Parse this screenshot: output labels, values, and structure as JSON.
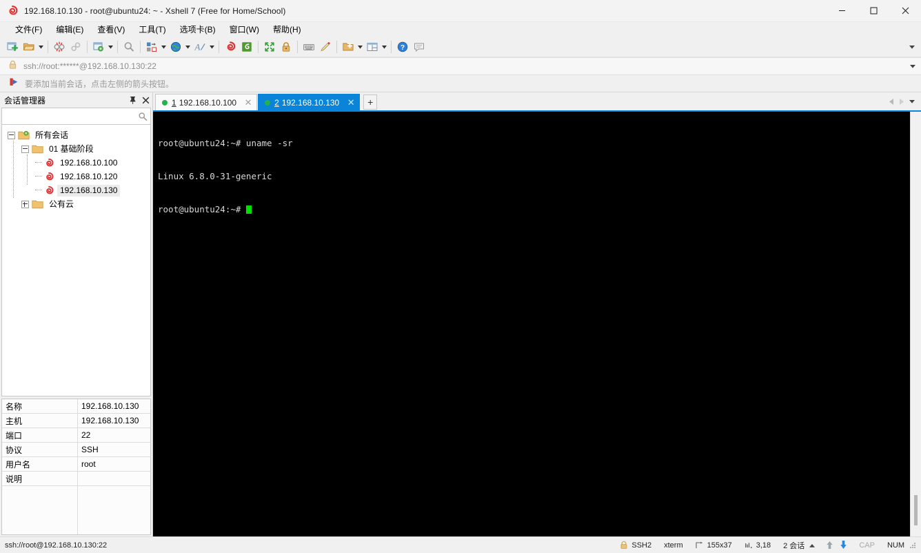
{
  "window": {
    "title": "192.168.10.130 - root@ubuntu24: ~ - Xshell 7 (Free for Home/School)",
    "app_icon": "xshell-logo-icon",
    "minimize_label": "─",
    "maximize_label": "□",
    "close_label": "✕"
  },
  "menu": {
    "items": [
      {
        "label": "文件(F)",
        "name": "menu-file"
      },
      {
        "label": "编辑(E)",
        "name": "menu-edit"
      },
      {
        "label": "查看(V)",
        "name": "menu-view"
      },
      {
        "label": "工具(T)",
        "name": "menu-tools"
      },
      {
        "label": "选项卡(B)",
        "name": "menu-tabs"
      },
      {
        "label": "窗口(W)",
        "name": "menu-window"
      },
      {
        "label": "帮助(H)",
        "name": "menu-help"
      }
    ]
  },
  "toolbar": {
    "buttons": [
      "new-session-icon",
      "open-folder-icon",
      "disconnect-icon",
      "reconnect-icon",
      "session-properties-icon",
      "find-icon",
      "transfer-layout-icon",
      "globe-encoding-icon",
      "font-icon",
      "xshell-icon",
      "xftp-icon",
      "fullscreen-icon",
      "lock-icon",
      "keyboard-icon",
      "highlight-pen-icon",
      "add-folder-icon",
      "split-layout-icon",
      "help-icon",
      "chat-icon"
    ],
    "overflow_label": "▾"
  },
  "address_bar": {
    "icon": "lock-icon",
    "value": "ssh://root:******@192.168.10.130:22",
    "dropdown_label": "▾"
  },
  "notification": {
    "icon": "red-arrow-icon",
    "message": "要添加当前会话，点击左侧的箭头按钮。"
  },
  "session_manager": {
    "title": "会话管理器",
    "pin_label": "⚑",
    "close_label": "✕",
    "search": {
      "value": "",
      "placeholder": "",
      "icon": "search-icon"
    },
    "tree": {
      "root": {
        "label": "所有会话",
        "icon": "folder-gear-icon",
        "expanded": true
      },
      "group": {
        "label": "01 基础阶段",
        "icon": "folder-icon",
        "expanded": true
      },
      "sessions": [
        {
          "label": "192.168.10.100",
          "icon": "xshell-session-icon",
          "selected": false
        },
        {
          "label": "192.168.10.120",
          "icon": "xshell-session-icon",
          "selected": false
        },
        {
          "label": "192.168.10.130",
          "icon": "xshell-session-icon",
          "selected": true
        }
      ],
      "cloud": {
        "label": "公有云",
        "icon": "folder-icon",
        "expanded": false
      }
    }
  },
  "properties": {
    "rows": [
      {
        "key": "名称",
        "value": "192.168.10.130"
      },
      {
        "key": "主机",
        "value": "192.168.10.130"
      },
      {
        "key": "端口",
        "value": "22"
      },
      {
        "key": "协议",
        "value": "SSH"
      },
      {
        "key": "用户名",
        "value": "root"
      },
      {
        "key": "说明",
        "value": ""
      }
    ]
  },
  "tabs": {
    "items": [
      {
        "number": "1",
        "label": "192.168.10.100",
        "active": false,
        "status": "connected",
        "close_label": "✕"
      },
      {
        "number": "2",
        "label": "192.168.10.130",
        "active": true,
        "status": "connected",
        "close_label": "✕"
      }
    ],
    "add_label": "+",
    "nav_prev": "◀",
    "nav_next": "▶",
    "nav_menu": "▾"
  },
  "terminal": {
    "lines": [
      "root@ubuntu24:~# uname -sr",
      "Linux 6.8.0-31-generic",
      "root@ubuntu24:~# "
    ],
    "background": "#000000",
    "foreground": "#d8d8d8",
    "cursor_color": "#00e000"
  },
  "statusbar": {
    "connection": "ssh://root@192.168.10.130:22",
    "protocol": "SSH2",
    "terminal_type": "xterm",
    "size": "155x37",
    "cursor_pos": "3,18",
    "sessions": "2 会话",
    "sessions_caret": "▴",
    "upload_icon": "arrow-up-icon",
    "download_icon": "arrow-down-icon",
    "caps": "CAP",
    "num": "NUM",
    "lock_icon": "lock-icon",
    "size_icon": "terminal-size-icon",
    "pos_icon": "cursor-pos-icon"
  },
  "colors": {
    "accent": "#0a84d8",
    "connected_dot": "#22b14c",
    "terminal_bg": "#000000",
    "cursor": "#00e000",
    "panel_bg": "#f0f0f0"
  }
}
